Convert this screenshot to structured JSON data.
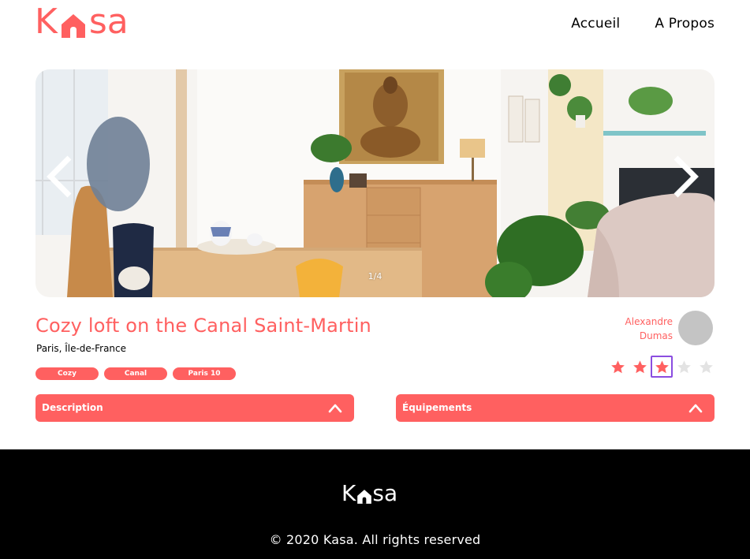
{
  "brand": {
    "logo_start": "K",
    "logo_end": "sa",
    "accent_color": "#FF6060"
  },
  "nav": {
    "items": [
      {
        "label": "Accueil"
      },
      {
        "label": "A Propos"
      }
    ]
  },
  "gallery": {
    "counter": "1/4"
  },
  "listing": {
    "title": "Cozy loft on the Canal Saint-Martin",
    "location": "Paris, Île-de-France",
    "tags": [
      "Cozy",
      "Canal",
      "Paris 10"
    ]
  },
  "host": {
    "first_name": "Alexandre",
    "last_name": "Dumas"
  },
  "rating": {
    "value": 3,
    "max": 5,
    "filled_color": "#FF6060",
    "empty_color": "#E3E3E3"
  },
  "collapses": [
    {
      "label": "Description",
      "icon": "chevron-up-icon"
    },
    {
      "label": "Équipements",
      "icon": "chevron-up-icon"
    }
  ],
  "footer": {
    "logo_start": "K",
    "logo_end": "sa",
    "copyright": "© 2020 Kasa. All rights reserved"
  }
}
